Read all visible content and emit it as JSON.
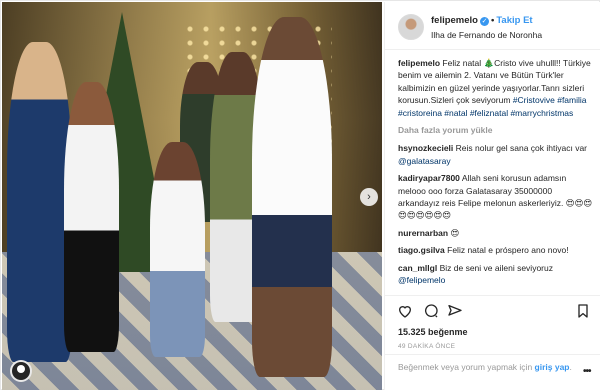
{
  "post": {
    "username": "felipemelo",
    "follow_label": "Takip Et",
    "location": "Ilha de Fernando de Noronha",
    "caption_user": "felipemelo",
    "caption_text": "Feliz natal 🎄Cristo vive uhulll!! Türkiye benim ve ailemin 2. Vatanı ve Bütün Türk'ler kalbimizin en güzel yerinde yaşıyorlar.Tanrı sizleri korusun.Sizleri çok seviyorum",
    "caption_tags": "#Cristovive #familia #cristoreina #natal #feliznatal #marrychristmas",
    "more_comments": "Daha fazla yorum yükle",
    "comments": [
      {
        "user": "hsynozkecieli",
        "text": "Reis nolur gel sana çok ihtiyacı var ",
        "tag": "@galatasaray"
      },
      {
        "user": "kadiryapar7800",
        "text": "Allah seni korusun adamsın melooo ooo forza Galatasaray 35000000 arkandayız reis Felipe melonun askerleriyiz. 😍😍😍😍😍😍😍😍😍",
        "tag": ""
      },
      {
        "user": "nurernarban",
        "text": "😍",
        "tag": ""
      },
      {
        "user": "tiago.gsilva",
        "text": "Feliz natal e próspero ano novo!",
        "tag": ""
      },
      {
        "user": "can_mllgl",
        "text": "Biz de seni ve aileni seviyoruz ",
        "tag": "@felipemelo"
      }
    ],
    "likes": "15.325 beğenme",
    "time_ago": "49 DAKİKA ÖNCE",
    "login_text": "Beğenmek veya yorum yapmak için ",
    "login_link": "giriş yap",
    "login_end": "."
  },
  "icons": [
    "heart-icon",
    "comment-icon",
    "share-icon",
    "bookmark-icon",
    "user-tag-icon",
    "next-arrow-icon",
    "more-options-icon"
  ],
  "colors": {
    "accent": "#3897f0",
    "muted": "#999999",
    "text": "#262626",
    "tag": "#003569"
  }
}
